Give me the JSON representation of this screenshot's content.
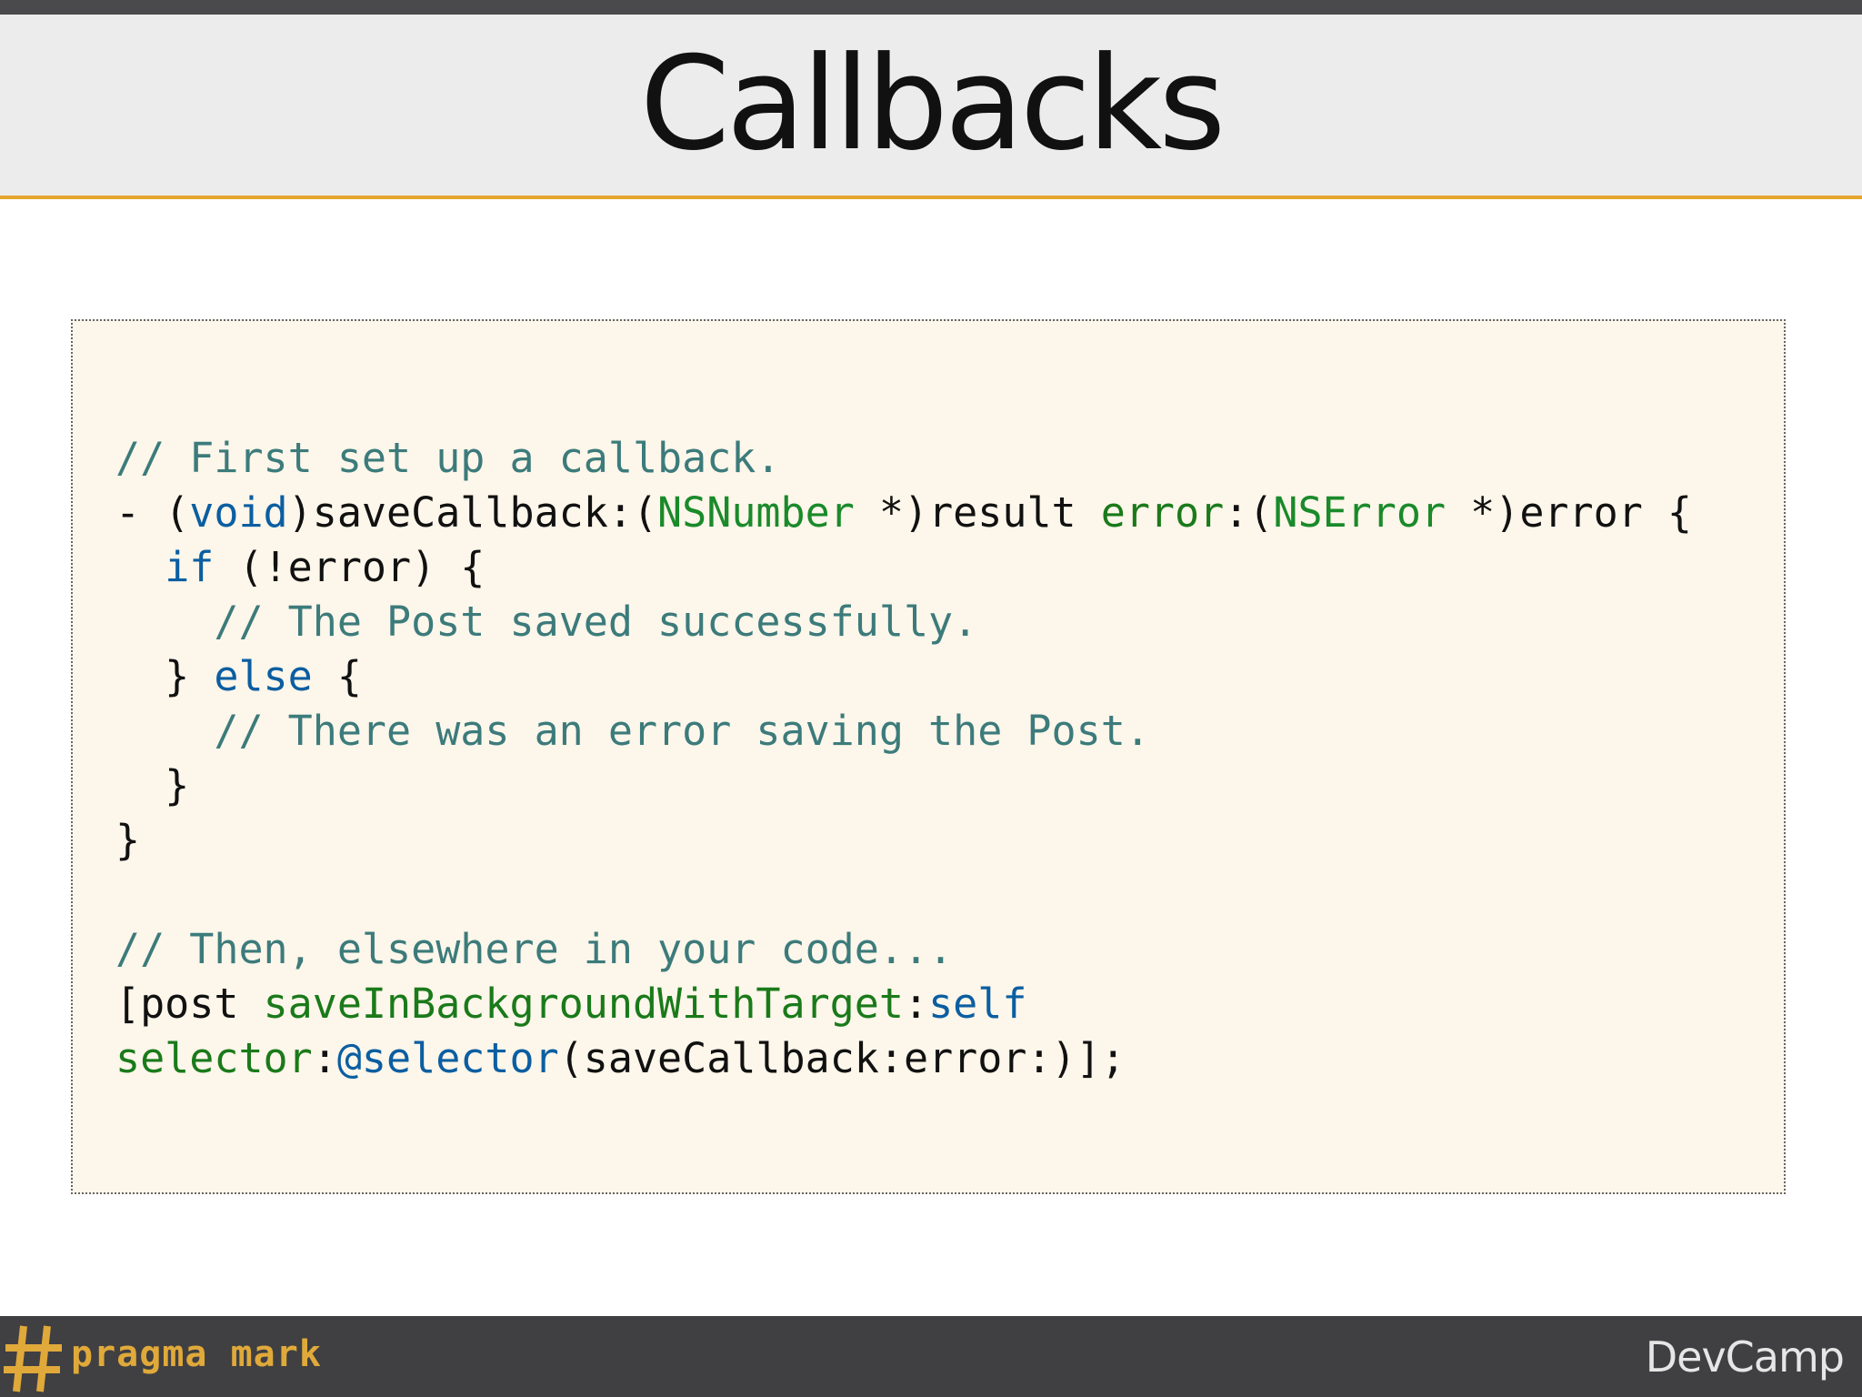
{
  "slide": {
    "title": "Callbacks"
  },
  "code_lines": [
    [
      {
        "cls": "c-comment",
        "text": "// First set up a callback."
      }
    ],
    [
      {
        "cls": "c-plain",
        "text": "- ("
      },
      {
        "cls": "c-kw",
        "text": "void"
      },
      {
        "cls": "c-plain",
        "text": ")saveCallback:("
      },
      {
        "cls": "c-type",
        "text": "NSNumber"
      },
      {
        "cls": "c-plain",
        "text": " *)result "
      },
      {
        "cls": "c-sel",
        "text": "error"
      },
      {
        "cls": "c-plain",
        "text": ":("
      },
      {
        "cls": "c-type",
        "text": "NSError"
      },
      {
        "cls": "c-plain",
        "text": " *)error {"
      }
    ],
    [
      {
        "cls": "c-plain",
        "text": "  "
      },
      {
        "cls": "c-kw",
        "text": "if"
      },
      {
        "cls": "c-plain",
        "text": " (!error) {"
      }
    ],
    [
      {
        "cls": "c-plain",
        "text": "    "
      },
      {
        "cls": "c-comment",
        "text": "// The Post saved successfully."
      }
    ],
    [
      {
        "cls": "c-plain",
        "text": "  } "
      },
      {
        "cls": "c-kw",
        "text": "else"
      },
      {
        "cls": "c-plain",
        "text": " {"
      }
    ],
    [
      {
        "cls": "c-plain",
        "text": "    "
      },
      {
        "cls": "c-comment",
        "text": "// There was an error saving the Post."
      }
    ],
    [
      {
        "cls": "c-plain",
        "text": "  }"
      }
    ],
    [
      {
        "cls": "c-plain",
        "text": "}"
      }
    ],
    [
      {
        "cls": "c-plain",
        "text": ""
      }
    ],
    [
      {
        "cls": "c-comment",
        "text": "// Then, elsewhere in your code..."
      }
    ],
    [
      {
        "cls": "c-plain",
        "text": "[post "
      },
      {
        "cls": "c-sel",
        "text": "saveInBackgroundWithTarget"
      },
      {
        "cls": "c-plain",
        "text": ":"
      },
      {
        "cls": "c-kw",
        "text": "self"
      }
    ],
    [
      {
        "cls": "c-sel",
        "text": "selector"
      },
      {
        "cls": "c-plain",
        "text": ":"
      },
      {
        "cls": "c-kw",
        "text": "@selector"
      },
      {
        "cls": "c-plain",
        "text": "(saveCallback:error:)];"
      }
    ]
  ],
  "footer": {
    "logo_text": "pragma mark",
    "brand": "DevCamp"
  },
  "colors": {
    "accent_rule": "#e5a52f",
    "code_background": "#fdf6ea",
    "footer_background": "#404042",
    "comment": "#3c7b7b",
    "keyword": "#0b5ea1",
    "type": "#1a8a2a"
  },
  "icons": {
    "logo": "hash-icon"
  }
}
